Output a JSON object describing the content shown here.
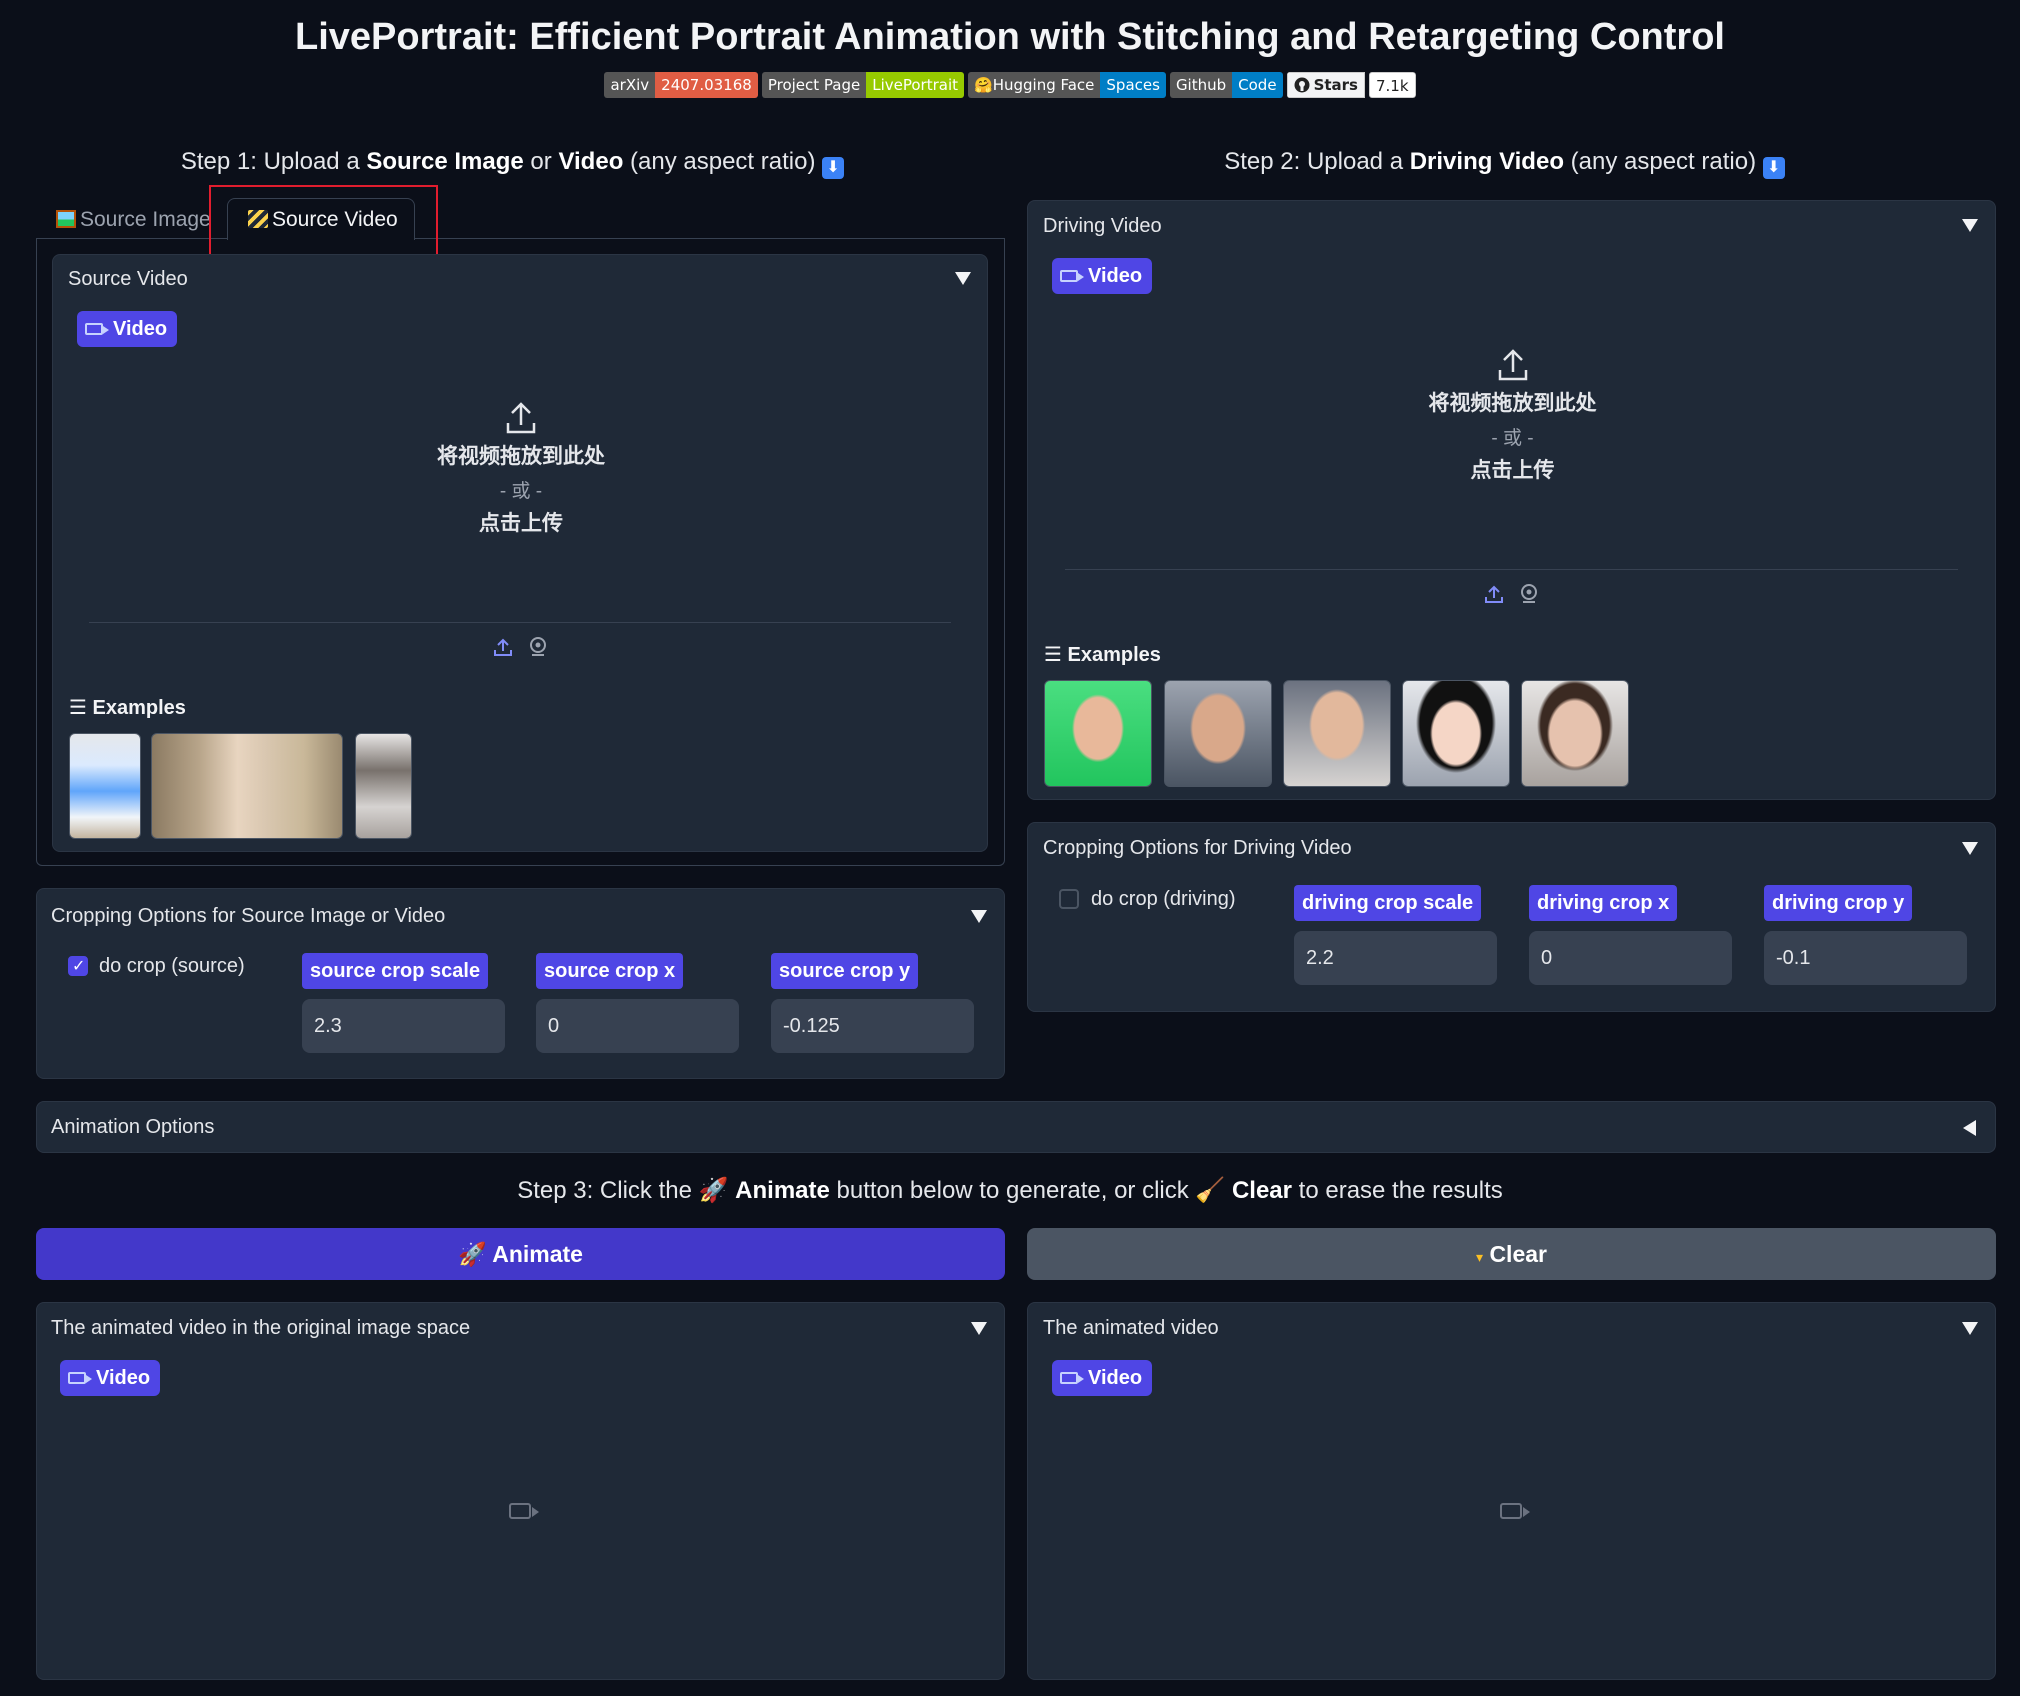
{
  "header": {
    "title": "LivePortrait: Efficient Portrait Animation with Stitching and Retargeting Control",
    "badges": [
      {
        "left": "arXiv",
        "right": "2407.03168"
      },
      {
        "left": "Project Page",
        "right": "LivePortrait"
      },
      {
        "left": "🤗Hugging Face",
        "right": "Spaces"
      },
      {
        "left": "Github",
        "right": "Code"
      }
    ],
    "stars_label": "Stars",
    "stars_count": "7.1k"
  },
  "step1": {
    "pre": "Step 1: Upload a ",
    "b1": "Source Image",
    "mid": " or ",
    "b2": "Video",
    "post": " (any aspect ratio)"
  },
  "step2": {
    "pre": "Step 2: Upload a ",
    "b1": "Driving Video",
    "post": " (any aspect ratio)"
  },
  "tabs": {
    "source_image": "Source Image",
    "source_video": "Source Video"
  },
  "source_panel": {
    "title": "Source Video",
    "badge": "Video",
    "drop_line1": "将视频拖放到此处",
    "drop_line2": "- 或 -",
    "drop_line3": "点击上传",
    "examples": "Examples"
  },
  "driving_panel": {
    "title": "Driving Video",
    "badge": "Video",
    "drop_line1": "将视频拖放到此处",
    "drop_line2": "- 或 -",
    "drop_line3": "点击上传",
    "examples": "Examples"
  },
  "source_crop": {
    "title": "Cropping Options for Source Image or Video",
    "checkbox_label": "do crop (source)",
    "checked": true,
    "scale_label": "source crop scale",
    "scale_value": "2.3",
    "x_label": "source crop x",
    "x_value": "0",
    "y_label": "source crop y",
    "y_value": "-0.125"
  },
  "driving_crop": {
    "title": "Cropping Options for Driving Video",
    "checkbox_label": "do crop (driving)",
    "checked": false,
    "scale_label": "driving crop scale",
    "scale_value": "2.2",
    "x_label": "driving crop x",
    "x_value": "0",
    "y_label": "driving crop y",
    "y_value": "-0.1"
  },
  "animation_options": {
    "title": "Animation Options"
  },
  "step3": {
    "pre": "Step 3: Click the 🚀 ",
    "b1": "Animate",
    "mid": " button below to generate, or click 🧹 ",
    "b2": "Clear",
    "post": " to erase the results"
  },
  "buttons": {
    "animate": "🚀 Animate",
    "clear": "Clear"
  },
  "output_left": {
    "title": "The animated video in the original image space",
    "badge": "Video"
  },
  "output_right": {
    "title": "The animated video",
    "badge": "Video"
  },
  "colors": {
    "accent": "#4f46e5",
    "background": "#0b0f19",
    "panel": "#1f2937",
    "highlight": "#e11d2e"
  }
}
